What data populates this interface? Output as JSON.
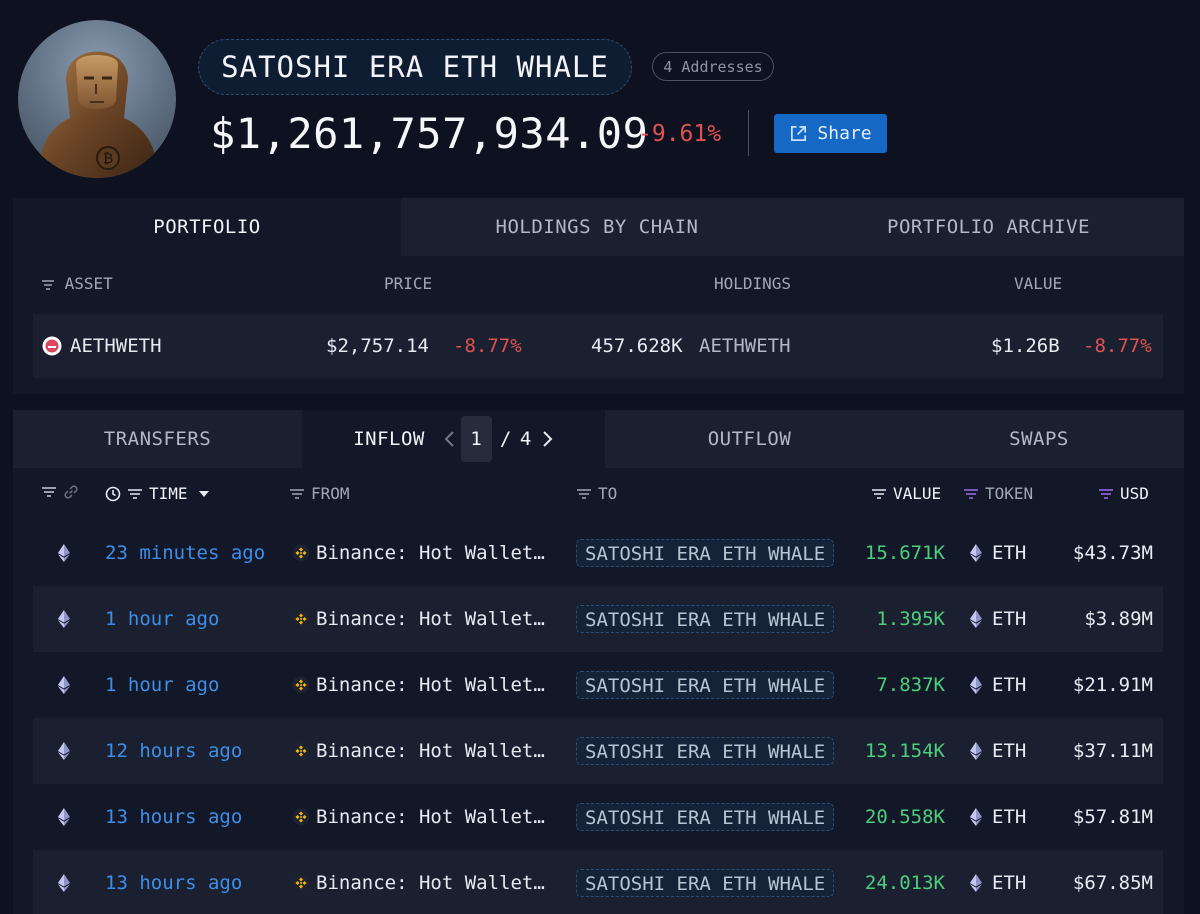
{
  "entity": {
    "name": "SATOSHI ERA ETH WHALE",
    "addresses_badge": "4 Addresses",
    "total_value": "$1,261,757,934.09",
    "total_change": "-9.61%",
    "share_label": "Share"
  },
  "portfolio": {
    "tabs": [
      "PORTFOLIO",
      "HOLDINGS BY CHAIN",
      "PORTFOLIO ARCHIVE"
    ],
    "columns": {
      "asset": "ASSET",
      "price": "PRICE",
      "holdings": "HOLDINGS",
      "value": "VALUE"
    },
    "rows": [
      {
        "asset": "AETHWETH",
        "price": "$2,757.14",
        "price_change": "-8.77%",
        "holdings_amount": "457.628K",
        "holdings_token": "AETHWETH",
        "value": "$1.26B",
        "value_change": "-8.77%"
      }
    ]
  },
  "transfers": {
    "tabs": {
      "transfers": "TRANSFERS",
      "inflow": "INFLOW",
      "outflow": "OUTFLOW",
      "swaps": "SWAPS"
    },
    "pager": {
      "current": "1",
      "separator": "/",
      "total": "4"
    },
    "columns": {
      "time": "TIME",
      "from": "FROM",
      "to": "TO",
      "value": "VALUE",
      "token": "TOKEN",
      "usd": "USD"
    },
    "rows": [
      {
        "time": "23 minutes ago",
        "from": "Binance: Hot Wallet…",
        "to": "SATOSHI ERA ETH WHALE",
        "value": "15.671K",
        "token": "ETH",
        "usd": "$43.73M"
      },
      {
        "time": "1 hour ago",
        "from": "Binance: Hot Wallet…",
        "to": "SATOSHI ERA ETH WHALE",
        "value": "1.395K",
        "token": "ETH",
        "usd": "$3.89M"
      },
      {
        "time": "1 hour ago",
        "from": "Binance: Hot Wallet…",
        "to": "SATOSHI ERA ETH WHALE",
        "value": "7.837K",
        "token": "ETH",
        "usd": "$21.91M"
      },
      {
        "time": "12 hours ago",
        "from": "Binance: Hot Wallet…",
        "to": "SATOSHI ERA ETH WHALE",
        "value": "13.154K",
        "token": "ETH",
        "usd": "$37.11M"
      },
      {
        "time": "13 hours ago",
        "from": "Binance: Hot Wallet…",
        "to": "SATOSHI ERA ETH WHALE",
        "value": "20.558K",
        "token": "ETH",
        "usd": "$57.81M"
      },
      {
        "time": "13 hours ago",
        "from": "Binance: Hot Wallet…",
        "to": "SATOSHI ERA ETH WHALE",
        "value": "24.013K",
        "token": "ETH",
        "usd": "$67.85M"
      }
    ]
  },
  "colors": {
    "background": "#0d1120",
    "panel": "#131829",
    "accent_blue": "#1569c4",
    "time_link": "#3e8ee8",
    "negative": "#e0524f",
    "positive": "#4ccf7c",
    "binance": "#f0b90b"
  },
  "icons": {
    "share": "external-link-icon",
    "sort": "filter-lines-icon",
    "clock": "clock-icon",
    "link": "link-icon",
    "chain": "ethereum-icon",
    "exchange": "binance-icon",
    "asset": "aave-weth-icon"
  }
}
